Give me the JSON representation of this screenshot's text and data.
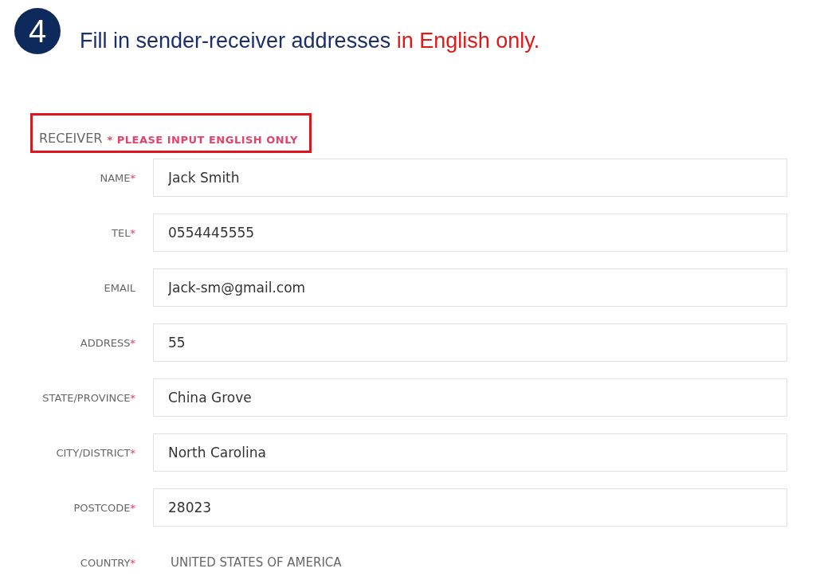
{
  "step": {
    "number": "4",
    "text": "Fill in sender-receiver addresses",
    "highlight": "in English only."
  },
  "section": {
    "title": "RECEIVER",
    "note": "* PLEASE INPUT ENGLISH ONLY"
  },
  "fields": [
    {
      "label": "NAME",
      "required_mark": "*",
      "value": "Jack Smith",
      "kind": "input"
    },
    {
      "label": "TEL",
      "required_mark": "*",
      "value": "0554445555",
      "kind": "input"
    },
    {
      "label": "EMAIL",
      "value": "Jack-sm@gmail.com",
      "kind": "input"
    },
    {
      "label": "ADDRESS",
      "required_mark": "*",
      "value": "55",
      "kind": "input"
    },
    {
      "label": "STATE/PROVINCE",
      "required_mark": "*",
      "value": "China Grove",
      "kind": "input"
    },
    {
      "label": "CITY/DISTRICT",
      "required_mark": "*",
      "value": "North Carolina",
      "kind": "input"
    },
    {
      "label": "POSTCODE",
      "required_mark": "*",
      "value": "28023",
      "kind": "input"
    },
    {
      "label": "COUNTRY",
      "required_mark": "*",
      "value": "UNITED STATES OF AMERICA",
      "kind": "text"
    }
  ]
}
